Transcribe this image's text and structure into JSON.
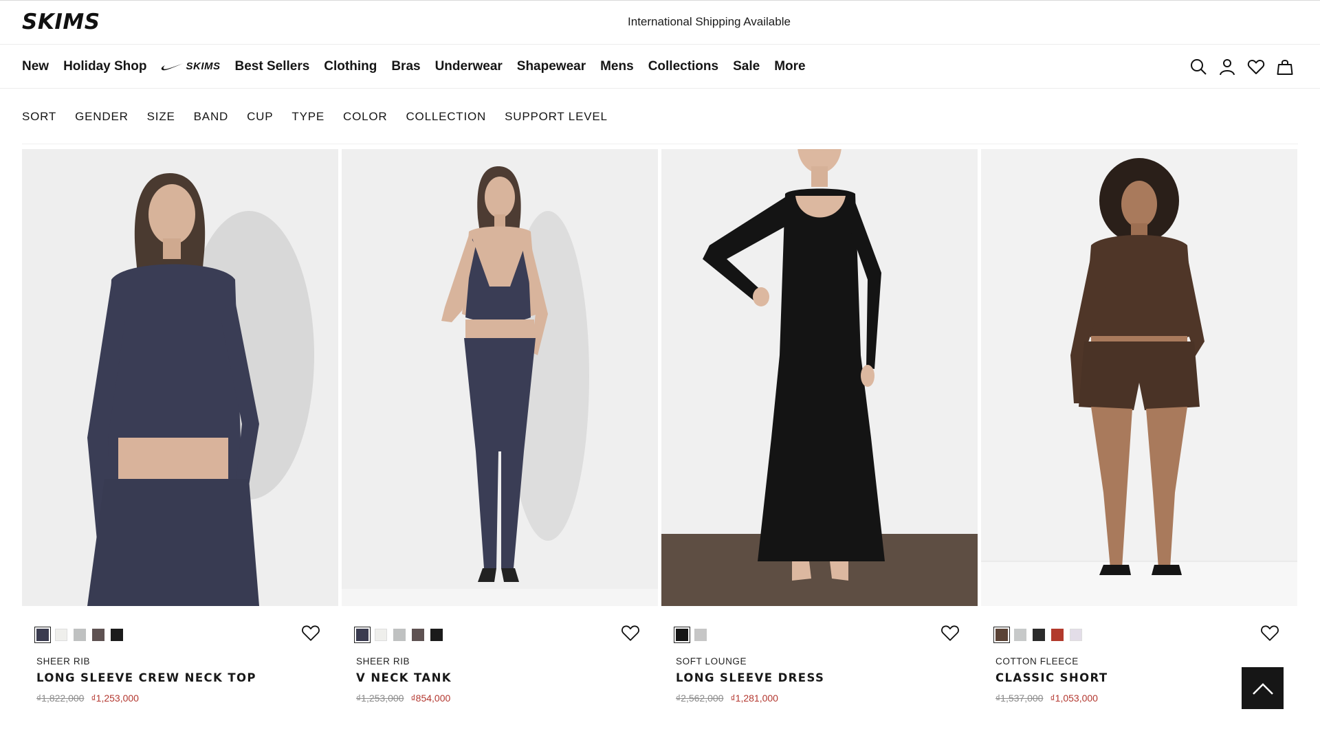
{
  "brand": "SKIMS",
  "announcement": "International Shipping Available",
  "nav": {
    "items_left": [
      "New",
      "Holiday Shop"
    ],
    "nike_label": "SKIMS",
    "items_right": [
      "Best Sellers",
      "Clothing",
      "Bras",
      "Underwear",
      "Shapewear",
      "Mens",
      "Collections",
      "Sale",
      "More"
    ],
    "icons": [
      "search-icon",
      "account-icon",
      "wishlist-icon",
      "bag-icon"
    ]
  },
  "filters": [
    "SORT",
    "GENDER",
    "SIZE",
    "BAND",
    "CUP",
    "TYPE",
    "COLOR",
    "COLLECTION",
    "SUPPORT LEVEL"
  ],
  "products": [
    {
      "collection": "SHEER RIB",
      "name": "LONG SLEEVE CREW NECK TOP",
      "old_price": "₫1,822,000",
      "price": "₫1,253,000",
      "swatches": [
        "#3a3b4f",
        "#efefec",
        "#bfc1c1",
        "#5e5252",
        "#1b1b1b"
      ],
      "selected_swatch": 0
    },
    {
      "collection": "SHEER RIB",
      "name": "V NECK TANK",
      "old_price": "₫1,253,000",
      "price": "₫854,000",
      "swatches": [
        "#3a3b4f",
        "#efefec",
        "#bfc1c1",
        "#5e5252",
        "#1b1b1b"
      ],
      "selected_swatch": 0
    },
    {
      "collection": "SOFT LOUNGE",
      "name": "LONG SLEEVE DRESS",
      "old_price": "₫2,562,000",
      "price": "₫1,281,000",
      "swatches": [
        "#161616",
        "#c6c6c6"
      ],
      "selected_swatch": 0
    },
    {
      "collection": "COTTON FLEECE",
      "name": "CLASSIC SHORT",
      "old_price": "₫1,537,000",
      "price": "₫1,053,000",
      "swatches": [
        "#5a4336",
        "#c7c9c9",
        "#2b2b2b",
        "#b23a2c",
        "#e3dde8"
      ],
      "selected_swatch": 0
    }
  ],
  "colors": {
    "sale_price": "#b3372f",
    "old_price": "#8a8a8a",
    "back_to_top_bg": "#161616"
  },
  "back_to_top_icon": "chevron-up-icon"
}
